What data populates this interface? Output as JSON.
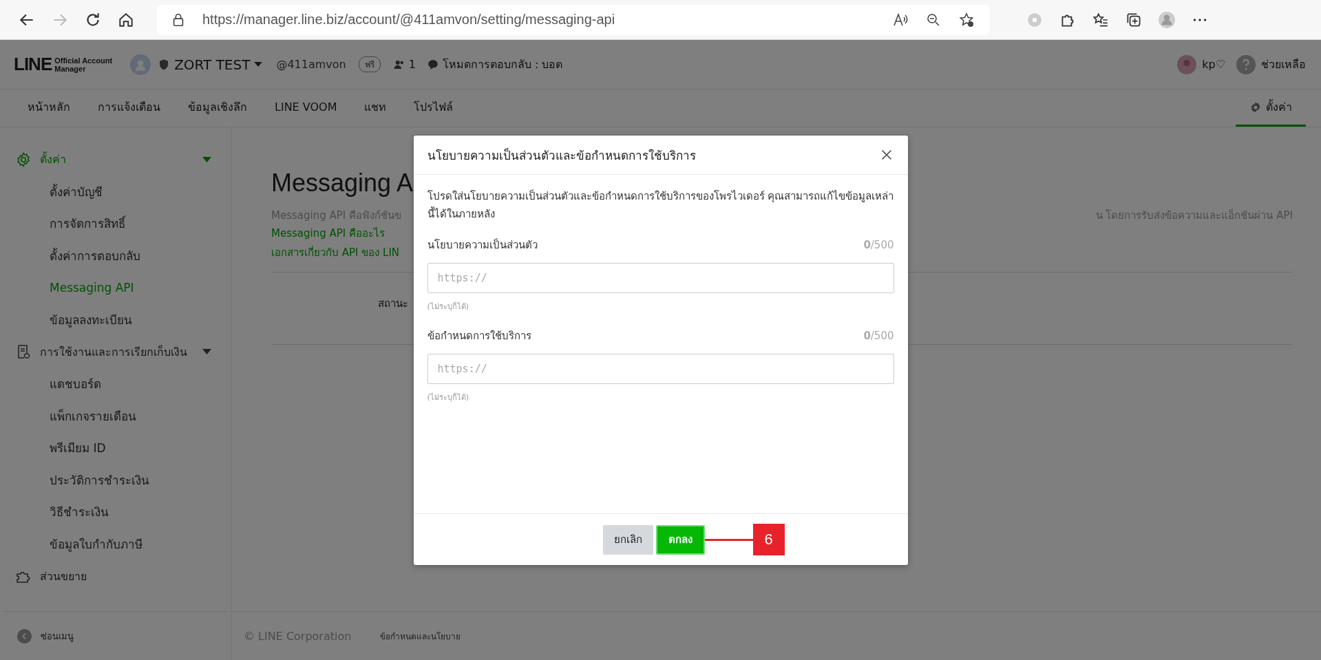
{
  "browser": {
    "url": "https://manager.line.biz/account/@411amvon/setting/messaging-api"
  },
  "header": {
    "logo_wordmark": "LINE",
    "logo_subtitle_1": "Official Account",
    "logo_subtitle_2": "Manager",
    "account_name": "ZORT TEST",
    "account_id": "@411amvon",
    "plan_badge": "ฟรี",
    "member_count": "1",
    "response_mode": "โหมดการตอบกลับ : บอต",
    "user_name": "kp♡",
    "help": "ช่วยเหลือ"
  },
  "nav": {
    "tabs": [
      {
        "label": "หน้าหลัก",
        "selected": false
      },
      {
        "label": "การแจ้งเตือน",
        "selected": false
      },
      {
        "label": "ข้อมูลเชิงลึก",
        "selected": false
      },
      {
        "label": "LINE VOOM",
        "selected": false
      },
      {
        "label": "แชท",
        "selected": false
      },
      {
        "label": "โปรไฟล์",
        "selected": false
      }
    ],
    "settings_tab": {
      "label": "ตั้งค่า",
      "selected": true
    }
  },
  "sidebar": {
    "sections": [
      {
        "label": "ตั้งค่า",
        "selected": true,
        "expanded": true,
        "children": [
          {
            "label": "ตั้งค่าบัญชี",
            "selected": false
          },
          {
            "label": "การจัดการสิทธิ์",
            "selected": false
          },
          {
            "label": "ตั้งค่าการตอบกลับ",
            "selected": false
          },
          {
            "label": "Messaging API",
            "selected": true
          },
          {
            "label": "ข้อมูลลงทะเบียน",
            "selected": false
          }
        ]
      },
      {
        "label": "การใช้งานและการเรียกเก็บเงิน",
        "selected": false,
        "expanded": true,
        "children": [
          {
            "label": "แดชบอร์ด",
            "selected": false
          },
          {
            "label": "แพ็กเกจรายเดือน",
            "selected": false
          },
          {
            "label": "พรีเมียม ID",
            "selected": false
          },
          {
            "label": "ประวัติการชำระเงิน",
            "selected": false
          },
          {
            "label": "วิธีชำระเงิน",
            "selected": false
          },
          {
            "label": "ข้อมูลใบกำกับภาษี",
            "selected": false
          }
        ]
      },
      {
        "label": "ส่วนขยาย",
        "selected": false
      }
    ],
    "collapse": "ซ่อนเมนู"
  },
  "main": {
    "title": "Messaging A",
    "description_left": "Messaging API คือฟังก์ชันข",
    "description_right": "น โดยการรับส่งข้อความและแอ็กชันผ่าน API",
    "links": [
      "Messaging API คืออะไร",
      "เอกสารเกี่ยวกับ API ของ LIN"
    ],
    "status_label": "สถานะ"
  },
  "footer": {
    "copyright": "© LINE Corporation",
    "terms": "ข้อกำหนดและนโยบาย"
  },
  "dialog": {
    "title": "นโยบายความเป็นส่วนตัวและข้อกำหนดการใช้บริการ",
    "description": "โปรดใส่นโยบายความเป็นส่วนตัวและข้อกำหนดการใช้บริการของโพรไวเดอร์ คุณสามารถแก้ไขข้อมูลเหล่านี้ได้ในภายหลัง",
    "fields": [
      {
        "label": "นโยบายความเป็นส่วนตัว",
        "count": "**0**/500",
        "placeholder": "https://",
        "hint": "(ไม่ระบุก็ได้)"
      },
      {
        "label": "ข้อกำหนดการใช้บริการ",
        "count": "**0**/500",
        "placeholder": "https://",
        "hint": "(ไม่ระบุก็ได้)"
      }
    ],
    "cancel": "ยกเลิก",
    "ok": "ตกลง",
    "callout": "6"
  }
}
